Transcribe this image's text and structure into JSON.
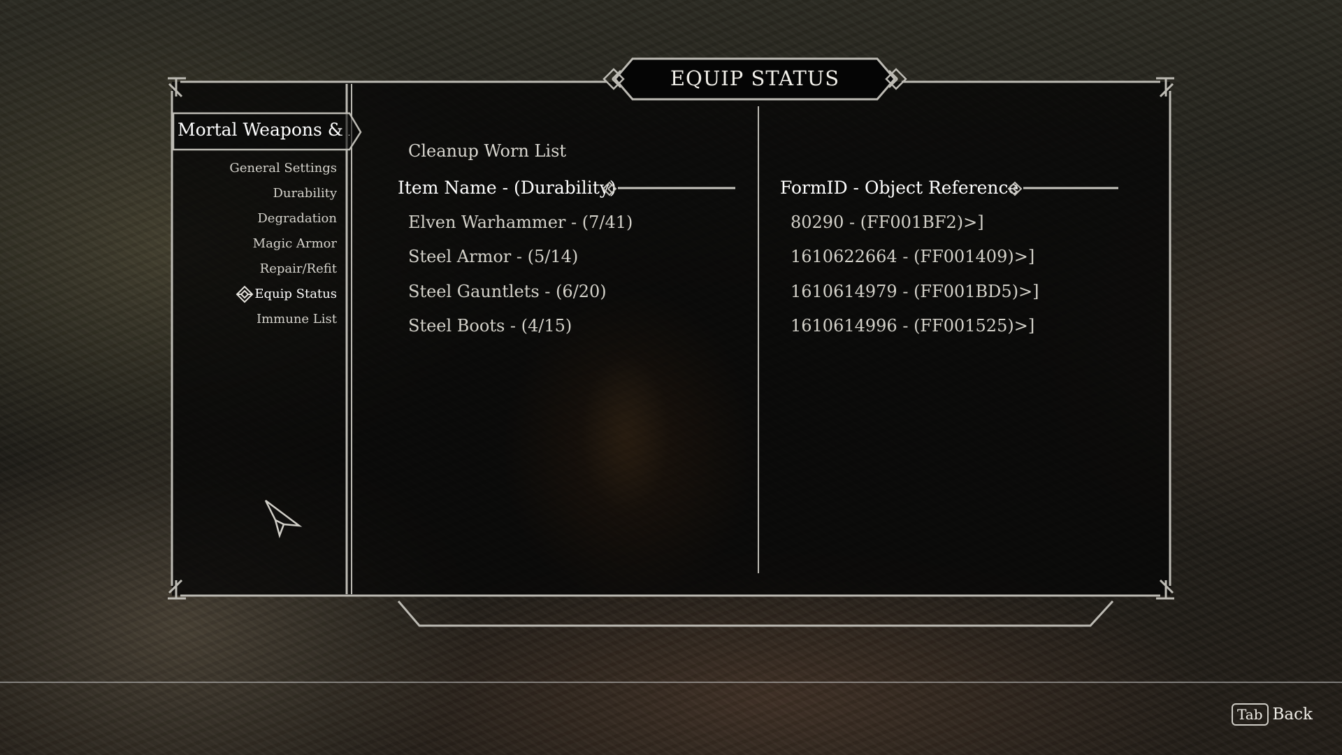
{
  "menu": {
    "title": "EQUIP STATUS",
    "mod_name": "Mortal Weapons & Ar",
    "pages": [
      {
        "label": "General Settings"
      },
      {
        "label": "Durability"
      },
      {
        "label": "Degradation"
      },
      {
        "label": "Magic Armor"
      },
      {
        "label": "Repair/Refit"
      },
      {
        "label": "Equip Status",
        "active": true
      },
      {
        "label": "Immune List"
      }
    ]
  },
  "content": {
    "cleanup_label": "Cleanup Worn List",
    "left_header": "Item Name - (Durability)",
    "right_header": "FormID - Object Reference",
    "items": [
      {
        "name": "Elven Warhammer - (7/41)",
        "ref": "80290 - (FF001BF2)>]"
      },
      {
        "name": "Steel Armor - (5/14)",
        "ref": "1610622664 - (FF001409)>]"
      },
      {
        "name": "Steel Gauntlets - (6/20)",
        "ref": "1610614979 - (FF001BD5)>]"
      },
      {
        "name": "Steel Boots - (4/15)",
        "ref": "1610614996 - (FF001525)>]"
      }
    ]
  },
  "footer": {
    "key": "Tab",
    "back_label": "Back"
  }
}
